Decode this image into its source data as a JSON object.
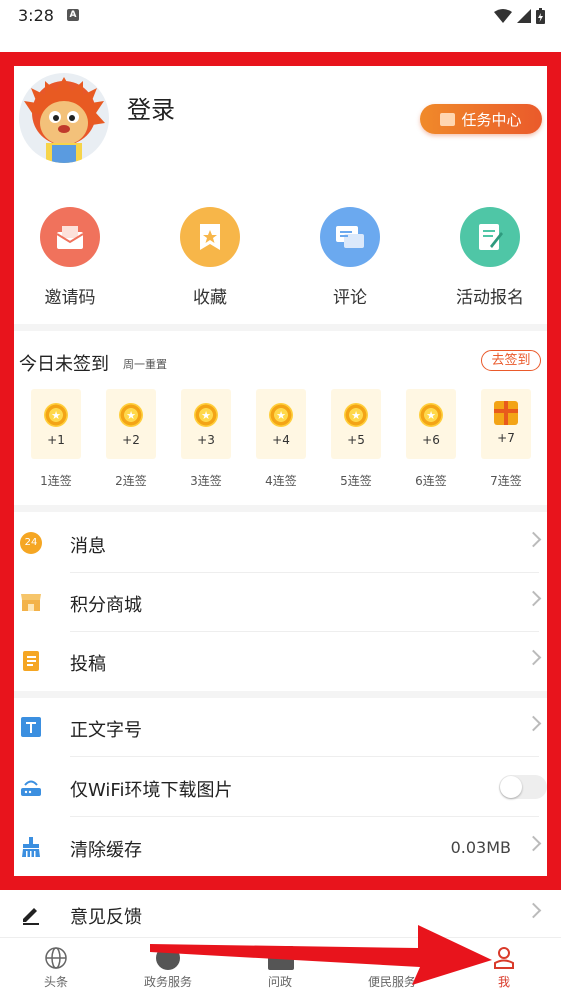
{
  "status_bar": {
    "time": "3:28"
  },
  "profile": {
    "login_label": "登录",
    "task_center_label": "任务中心"
  },
  "shortcuts": [
    {
      "label": "邀请码",
      "icon": "envelope-icon",
      "color": "#f0725c"
    },
    {
      "label": "收藏",
      "icon": "bookmark-star-icon",
      "color": "#f7b649"
    },
    {
      "label": "评论",
      "icon": "chat-bubble-icon",
      "color": "#6ba9ef"
    },
    {
      "label": "活动报名",
      "icon": "form-pen-icon",
      "color": "#4fc6a6"
    }
  ],
  "sign_in": {
    "title": "今日未签到",
    "subtitle": "周一重置",
    "button_label": "去签到",
    "days": [
      {
        "points": "+1",
        "label": "1连签"
      },
      {
        "points": "+2",
        "label": "2连签"
      },
      {
        "points": "+3",
        "label": "3连签"
      },
      {
        "points": "+4",
        "label": "4连签"
      },
      {
        "points": "+5",
        "label": "5连签"
      },
      {
        "points": "+6",
        "label": "6连签"
      },
      {
        "points": "+7",
        "label": "7连签"
      }
    ]
  },
  "menu": [
    {
      "label": "消息",
      "icon": "message-badge-icon",
      "badge": "24"
    },
    {
      "label": "积分商城",
      "icon": "store-icon"
    },
    {
      "label": "投稿",
      "icon": "document-icon"
    }
  ],
  "settings": [
    {
      "label": "正文字号",
      "icon": "font-size-icon"
    },
    {
      "label": "仅WiFi环境下载图片",
      "icon": "wifi-router-icon",
      "toggle_on": false
    },
    {
      "label": "清除缓存",
      "icon": "broom-icon",
      "value": "0.03MB"
    }
  ],
  "feedback": {
    "label": "意见反馈",
    "icon": "pen-icon"
  },
  "bottom_nav": [
    {
      "label": "头条",
      "icon": "globe-icon",
      "active": false
    },
    {
      "label": "政务服务",
      "icon": "gov-service-icon",
      "active": false
    },
    {
      "label": "问政",
      "icon": "inquiry-icon",
      "active": false
    },
    {
      "label": "便民服务",
      "icon": "service-icon",
      "active": false
    },
    {
      "label": "我",
      "icon": "user-icon",
      "active": true
    }
  ],
  "colors": {
    "accent": "#ea5a2b",
    "annotation_red": "#e8141c",
    "active_tab": "#d93a2a"
  }
}
